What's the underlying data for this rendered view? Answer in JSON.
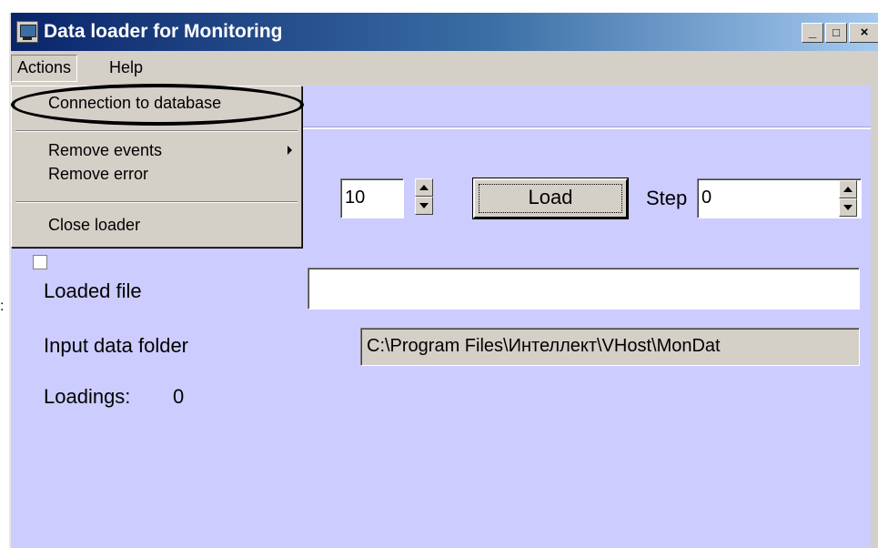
{
  "window": {
    "title": "Data loader for Monitoring",
    "minimize": "_",
    "maximize": "□",
    "close": "×"
  },
  "menubar": {
    "items": [
      "Actions",
      "Help"
    ]
  },
  "actions_menu": {
    "items": [
      "Connection to database",
      "Remove events",
      "Remove error",
      "Close loader"
    ]
  },
  "controls": {
    "count_value": "10",
    "load_button": "Load",
    "step_label": "Step",
    "step_value": "0",
    "loaded_file_label": "Loaded file",
    "loaded_file_value": "",
    "input_folder_label": "Input data folder",
    "input_folder_value": "C:\\Program Files\\Интеллект\\VHost\\MonDat",
    "loadings_label": "Loadings:",
    "loadings_value": "0"
  }
}
